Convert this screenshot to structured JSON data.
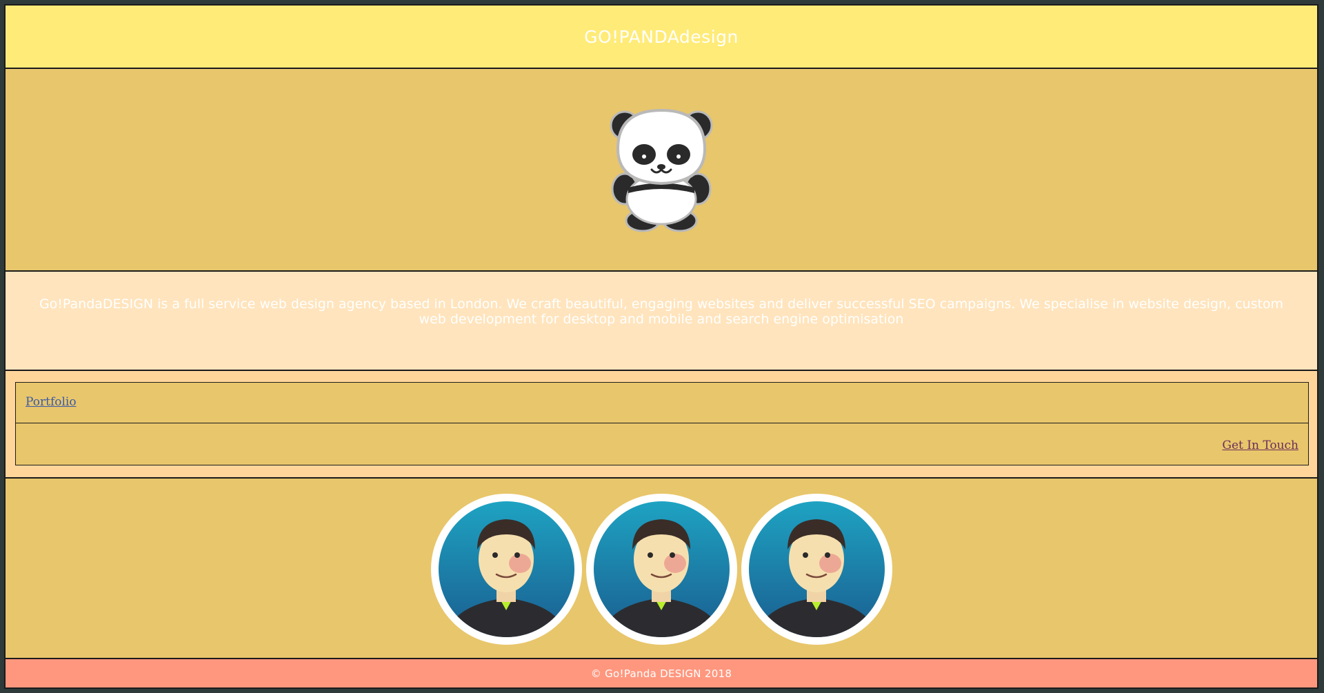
{
  "header": {
    "title": "GO!PANDAdesign"
  },
  "hero": {
    "logo_icon": "panda-icon"
  },
  "intro": {
    "text": "Go!PandaDESIGN is a full service web design agency based in London. We craft beautiful, engaging websites and deliver successful SEO campaigns. We specialise in website design, custom web development for desktop and mobile and search engine optimisation"
  },
  "links": {
    "portfolio_label": "Portfolio",
    "contact_label": "Get In Touch"
  },
  "team": {
    "avatars": [
      "avatar-icon",
      "avatar-icon",
      "avatar-icon"
    ]
  },
  "footer": {
    "copyright": "© Go!Panda DESIGN 2018"
  },
  "colors": {
    "header_bg": "#ffeb78",
    "section_bg": "#e8c66b",
    "intro_bg": "#ffe4bd",
    "links_bg": "#ffd59a",
    "footer_bg": "#ff977e",
    "link_blue": "#3b5aa8",
    "link_purple": "#6c2e5a"
  }
}
